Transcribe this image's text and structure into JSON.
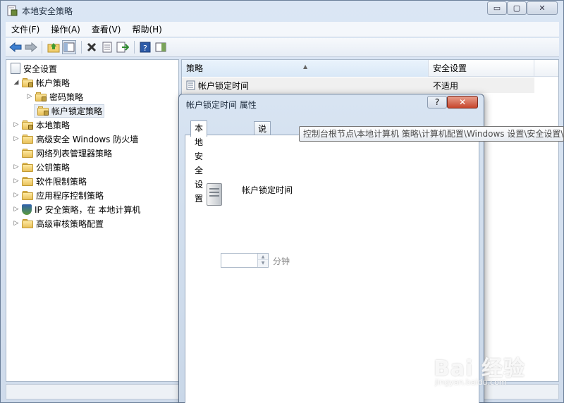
{
  "window": {
    "title": "本地安全策略"
  },
  "caption_buttons": {
    "minimize": "▭",
    "maximize": "▢",
    "close": "✕"
  },
  "menu": [
    "文件(F)",
    "操作(A)",
    "查看(V)",
    "帮助(H)"
  ],
  "toolbar": {
    "icons": [
      "back-arrow-icon",
      "forward-arrow-icon",
      "up-folder-icon",
      "show-hide-tree-icon",
      "delete-icon",
      "properties-icon",
      "export-list-icon",
      "help-icon",
      "show-action-pane-icon"
    ]
  },
  "tree": [
    {
      "label": "安全设置",
      "level": 0,
      "expander": "",
      "icon": "doc-icon"
    },
    {
      "label": "帐户策略",
      "level": 1,
      "expander": "◢",
      "icon": "folder-lock-icon"
    },
    {
      "label": "密码策略",
      "level": 2,
      "expander": "▷",
      "icon": "folder-lock-icon"
    },
    {
      "label": "帐户锁定策略",
      "level": 2,
      "expander": "",
      "icon": "folder-lock-icon",
      "selected": true
    },
    {
      "label": "本地策略",
      "level": 1,
      "expander": "▷",
      "icon": "folder-lock-icon"
    },
    {
      "label": "高级安全 Windows 防火墙",
      "level": 1,
      "expander": "▷",
      "icon": "folder-icon"
    },
    {
      "label": "网络列表管理器策略",
      "level": 1,
      "expander": "",
      "icon": "folder-icon"
    },
    {
      "label": "公钥策略",
      "level": 1,
      "expander": "▷",
      "icon": "folder-icon"
    },
    {
      "label": "软件限制策略",
      "level": 1,
      "expander": "▷",
      "icon": "folder-icon"
    },
    {
      "label": "应用程序控制策略",
      "level": 1,
      "expander": "▷",
      "icon": "folder-icon"
    },
    {
      "label": "IP 安全策略，在 本地计算机",
      "level": 1,
      "expander": "▷",
      "icon": "shield-icon"
    },
    {
      "label": "高级审核策略配置",
      "level": 1,
      "expander": "▷",
      "icon": "folder-icon"
    }
  ],
  "list": {
    "columns": [
      "策略",
      "安全设置"
    ],
    "rows": [
      {
        "policy": "帐户锁定时间",
        "setting": "不适用"
      }
    ]
  },
  "dialog": {
    "title": "帐户锁定时间 属性",
    "help": "?",
    "close": "✕",
    "tabs": [
      "本地安全设置",
      "说明"
    ],
    "active_tab": 0,
    "policy_name": "帐户锁定时间",
    "duration_value": "",
    "unit": "分钟"
  },
  "tooltip": "控制台根节点\\本地计算机 策略\\计算机配置\\Windows 设置\\安全设置\\",
  "watermark": {
    "main": "Bai 经验",
    "sub": "jingyan.baidu.com"
  }
}
